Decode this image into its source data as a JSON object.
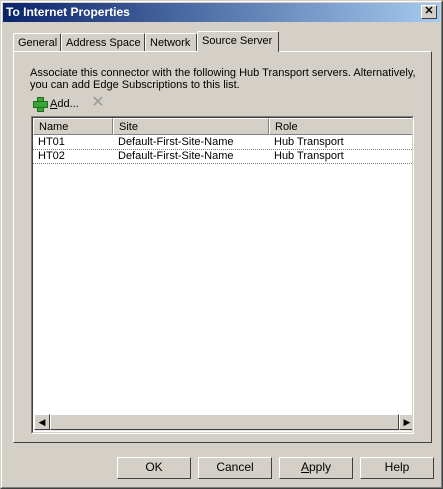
{
  "window": {
    "title": "To Internet Properties",
    "close_label": "✕"
  },
  "tabs": [
    {
      "label": "General"
    },
    {
      "label": "Address Space"
    },
    {
      "label": "Network"
    },
    {
      "label": "Source Server"
    }
  ],
  "description": "Associate this connector with the following Hub Transport servers. Alternatively, you can add Edge Subscriptions to this list.",
  "toolbar": {
    "add_label": "Add..."
  },
  "list": {
    "columns": [
      "Name",
      "Site",
      "Role"
    ],
    "rows": [
      [
        "HT01",
        "Default-First-Site-Name",
        "Hub Transport"
      ],
      [
        "HT02",
        "Default-First-Site-Name",
        "Hub Transport"
      ]
    ]
  },
  "scrollbar": {
    "left_arrow": "◀",
    "right_arrow": "▶"
  },
  "buttons": {
    "ok": "OK",
    "cancel": "Cancel",
    "apply": "Apply",
    "help": "Help"
  }
}
